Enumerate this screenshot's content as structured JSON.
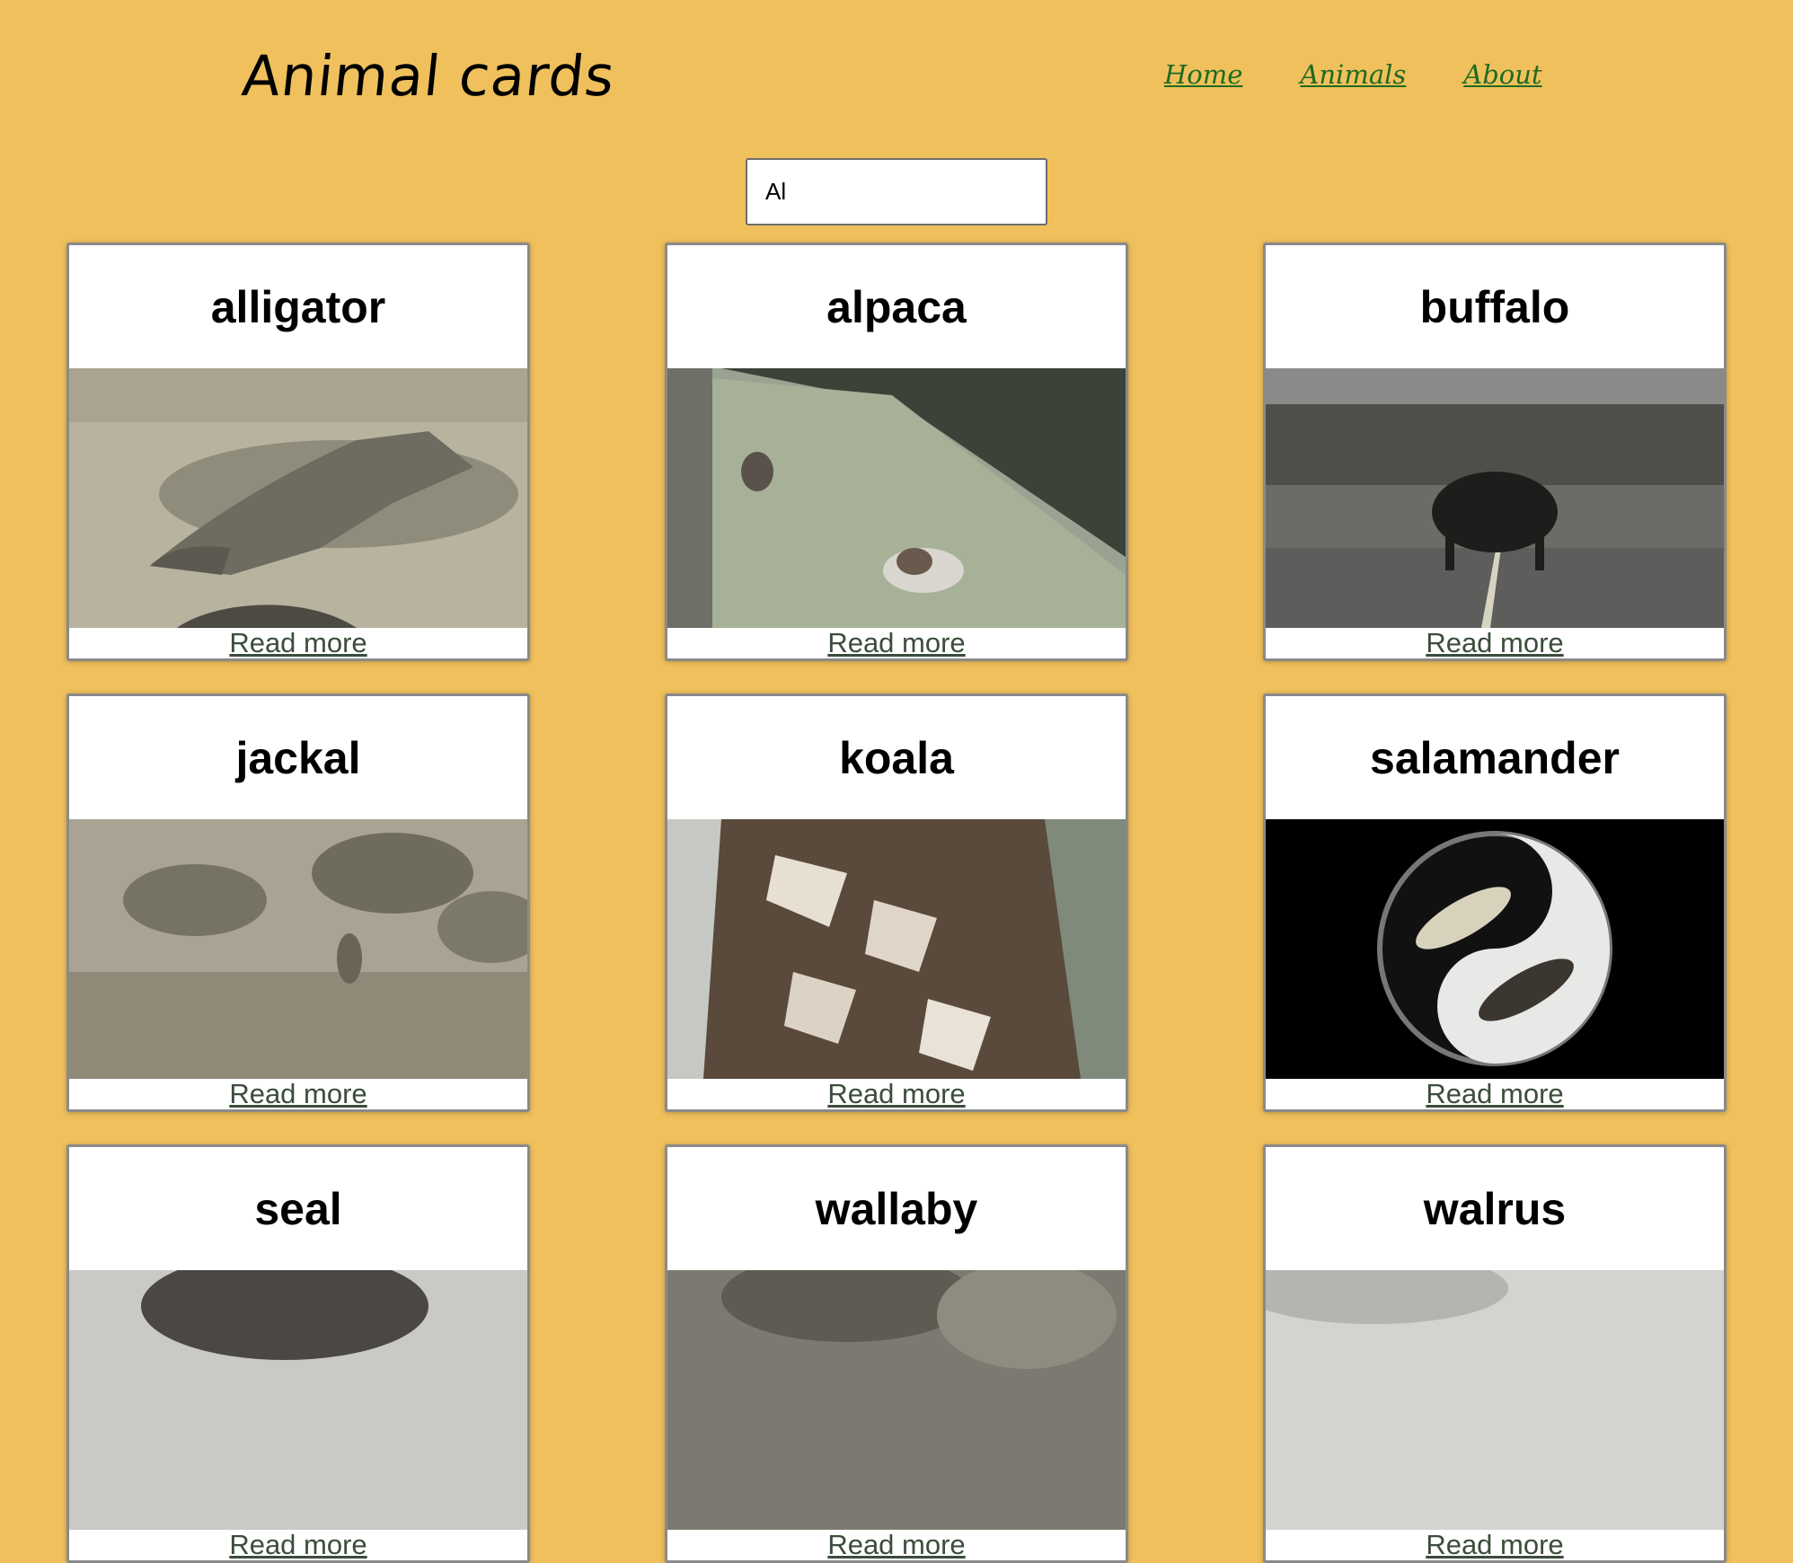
{
  "header": {
    "title": "Animal cards",
    "nav": [
      "Home",
      "Animals",
      "About"
    ]
  },
  "search": {
    "value": "Al"
  },
  "cards": [
    {
      "name": "alligator",
      "link": "Read more",
      "image": "alligator-photo"
    },
    {
      "name": "alpaca",
      "link": "Read more",
      "image": "alpaca-photo"
    },
    {
      "name": "buffalo",
      "link": "Read more",
      "image": "buffalo-photo"
    },
    {
      "name": "jackal",
      "link": "Read more",
      "image": "jackal-photo"
    },
    {
      "name": "koala",
      "link": "Read more",
      "image": "owl-photo"
    },
    {
      "name": "salamander",
      "link": "Read more",
      "image": "koi-yin-yang-photo"
    },
    {
      "name": "seal",
      "link": "Read more",
      "image": "seal-photo"
    },
    {
      "name": "wallaby",
      "link": "Read more",
      "image": "wallaby-photo"
    },
    {
      "name": "walrus",
      "link": "Read more",
      "image": "walrus-photo"
    }
  ],
  "colors": {
    "background": "#efc05c",
    "nav_link": "#1f6a1f",
    "card_border": "#8a8a8a",
    "read_more": "#3b4d3b"
  }
}
